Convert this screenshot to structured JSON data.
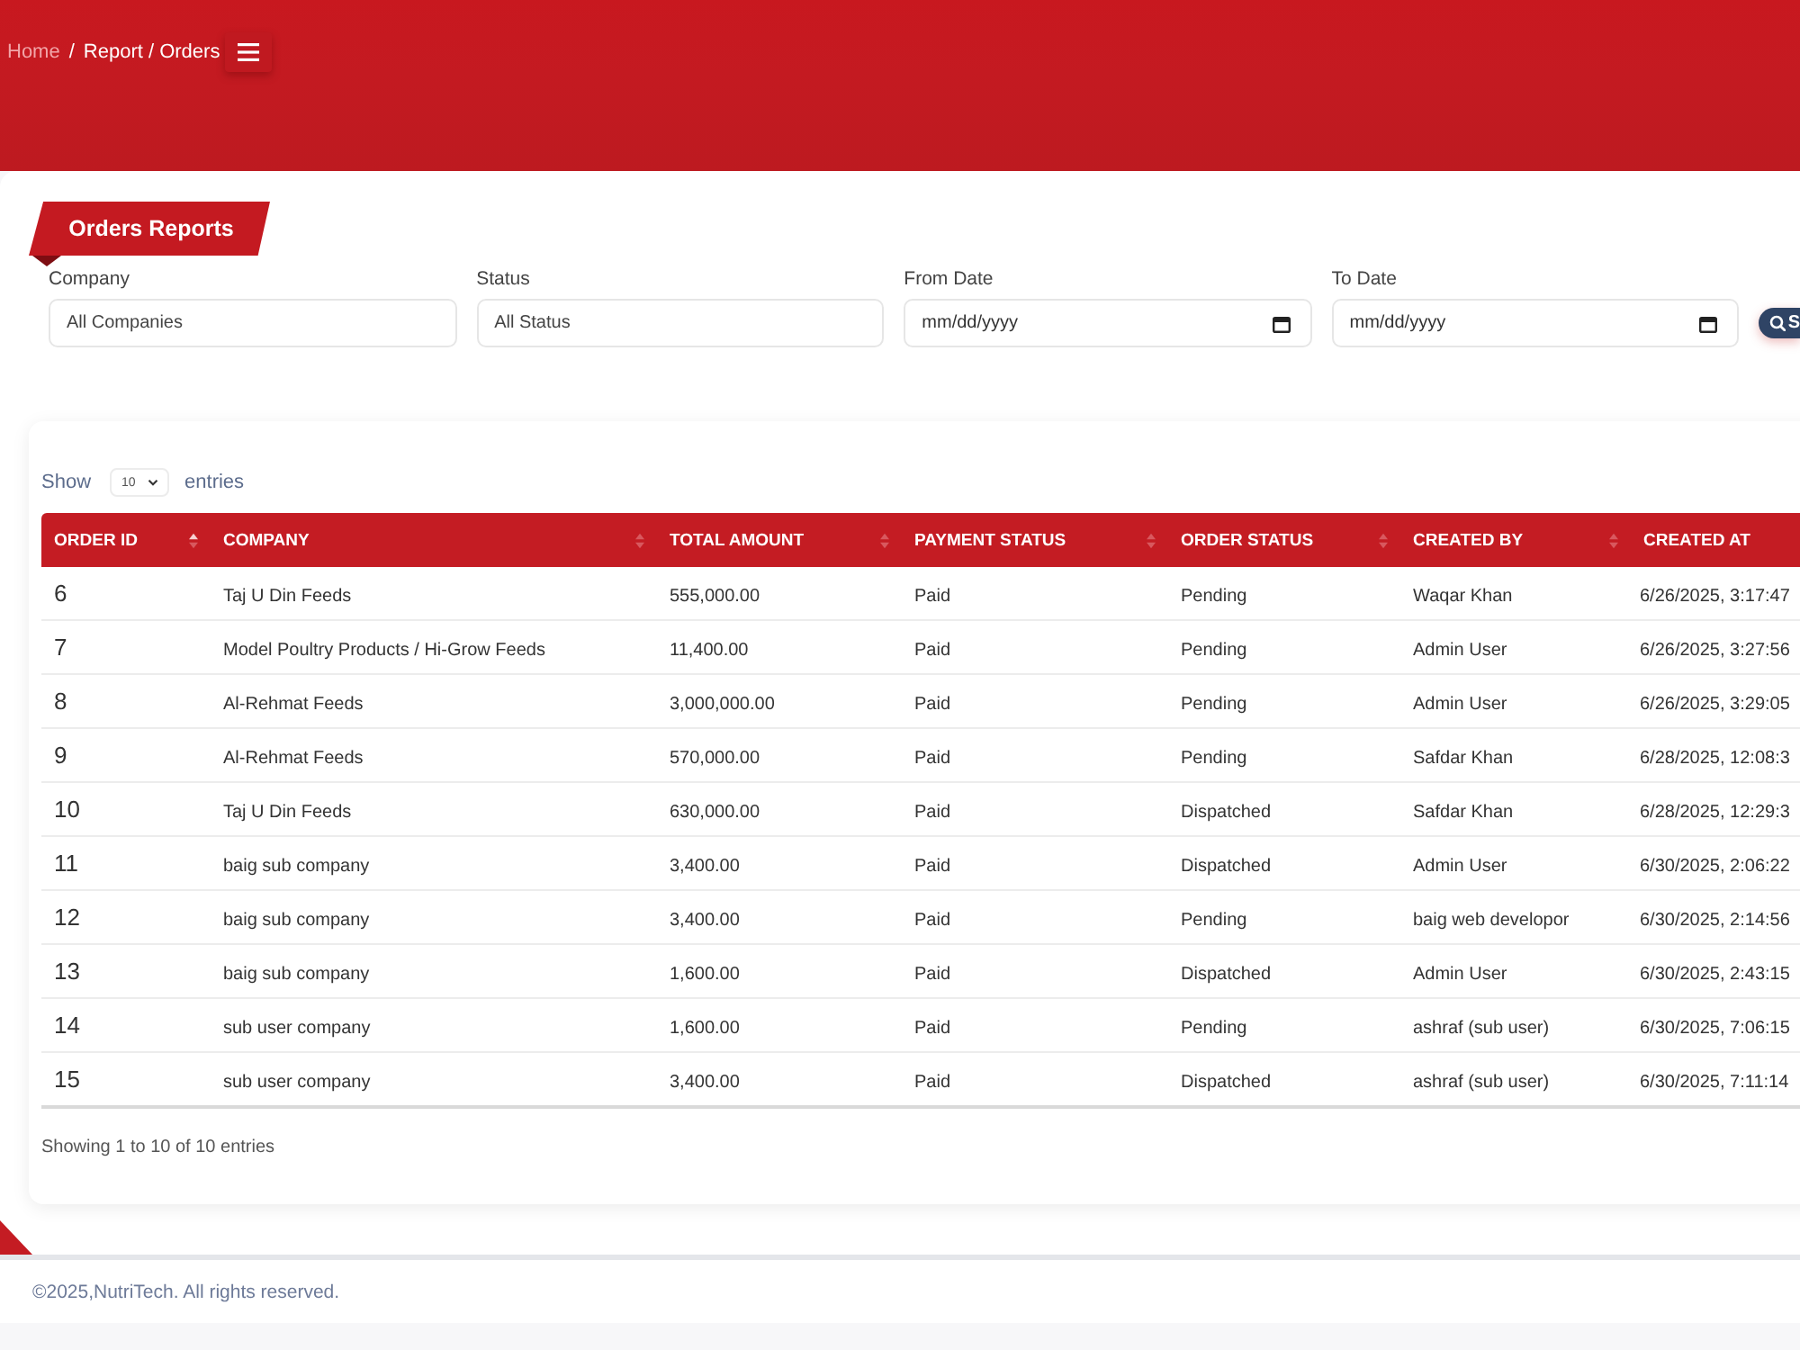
{
  "breadcrumb": {
    "separator": "/",
    "items": [
      {
        "label": "Home",
        "current": false
      },
      {
        "label": "Report / Orders",
        "current": true
      }
    ]
  },
  "page_title": "Orders Reports",
  "filters": [
    {
      "kind": "select",
      "label": "Company",
      "value": "All Companies"
    },
    {
      "kind": "select",
      "label": "Status",
      "value": "All Status"
    },
    {
      "kind": "date",
      "label": "From Date",
      "placeholder": "mm/dd/yyyy"
    },
    {
      "kind": "date",
      "label": "To Date",
      "placeholder": "mm/dd/yyyy"
    }
  ],
  "search_button": {
    "label": "S"
  },
  "length_menu": {
    "prefix": "Show",
    "value": "10",
    "suffix": "entries"
  },
  "table": {
    "columns": [
      {
        "label": "ORDER ID",
        "sorted": true
      },
      {
        "label": "COMPANY",
        "sorted": false
      },
      {
        "label": "TOTAL AMOUNT",
        "sorted": false
      },
      {
        "label": "PAYMENT STATUS",
        "sorted": false
      },
      {
        "label": "ORDER STATUS",
        "sorted": false
      },
      {
        "label": "CREATED BY",
        "sorted": false
      },
      {
        "label": "CREATED AT"
      }
    ],
    "rows": [
      [
        "6",
        "Taj U Din Feeds",
        "555,000.00",
        "Paid",
        "Pending",
        "Waqar Khan",
        "6/26/2025, 3:17:47"
      ],
      [
        "7",
        "Model Poultry Products / Hi-Grow Feeds",
        "11,400.00",
        "Paid",
        "Pending",
        "Admin User",
        "6/26/2025, 3:27:56"
      ],
      [
        "8",
        "Al-Rehmat Feeds",
        "3,000,000.00",
        "Paid",
        "Pending",
        "Admin User",
        "6/26/2025, 3:29:05"
      ],
      [
        "9",
        "Al-Rehmat Feeds",
        "570,000.00",
        "Paid",
        "Pending",
        "Safdar Khan",
        "6/28/2025, 12:08:3"
      ],
      [
        "10",
        "Taj U Din Feeds",
        "630,000.00",
        "Paid",
        "Dispatched",
        "Safdar Khan",
        "6/28/2025, 12:29:3"
      ],
      [
        "11",
        "baig sub company",
        "3,400.00",
        "Paid",
        "Dispatched",
        "Admin User",
        "6/30/2025, 2:06:22"
      ],
      [
        "12",
        "baig sub company",
        "3,400.00",
        "Paid",
        "Pending",
        "baig web developor",
        "6/30/2025, 2:14:56"
      ],
      [
        "13",
        "baig sub company",
        "1,600.00",
        "Paid",
        "Dispatched",
        "Admin User",
        "6/30/2025, 2:43:15"
      ],
      [
        "14",
        "sub user company",
        "1,600.00",
        "Paid",
        "Pending",
        "ashraf (sub user)",
        "6/30/2025, 7:06:15"
      ],
      [
        "15",
        "sub user company",
        "3,400.00",
        "Paid",
        "Dispatched",
        "ashraf (sub user)",
        "6/30/2025, 7:11:14"
      ]
    ]
  },
  "table_info": "Showing 1 to 10 of 10 entries",
  "footer": "©2025,NutriTech. All rights reserved."
}
